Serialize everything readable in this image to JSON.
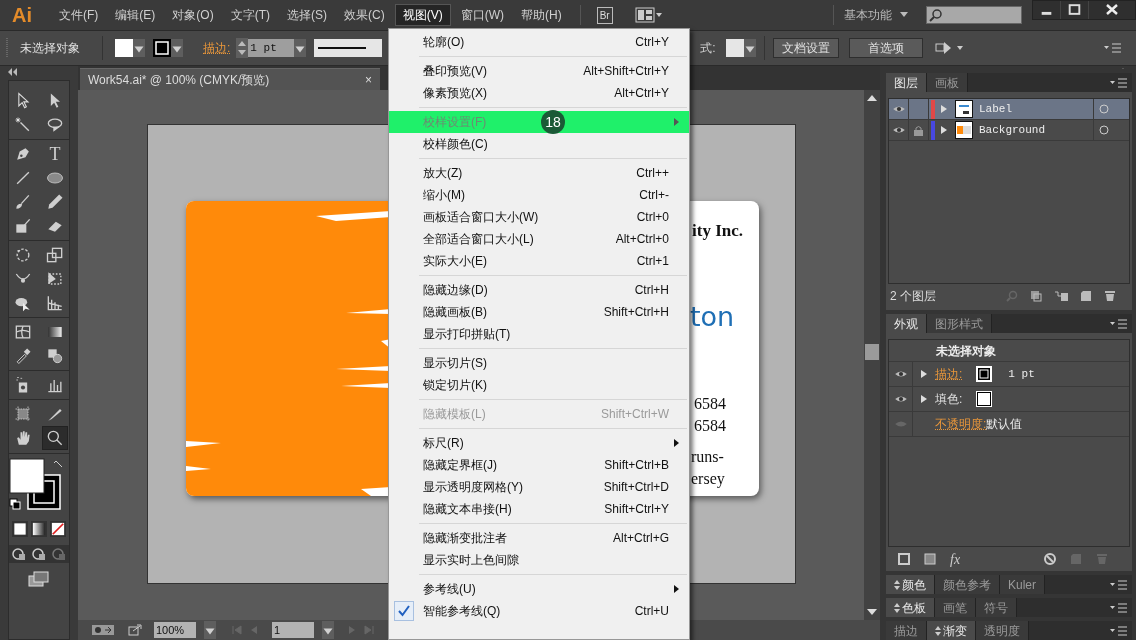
{
  "menubar": {
    "logo": "Ai",
    "menus": [
      {
        "label": "文件(F)",
        "selected": false
      },
      {
        "label": "编辑(E)",
        "selected": false
      },
      {
        "label": "对象(O)",
        "selected": false
      },
      {
        "label": "文字(T)",
        "selected": false
      },
      {
        "label": "选择(S)",
        "selected": false
      },
      {
        "label": "效果(C)",
        "selected": false
      },
      {
        "label": "视图(V)",
        "selected": true
      },
      {
        "label": "窗口(W)",
        "selected": false
      },
      {
        "label": "帮助(H)",
        "selected": false
      }
    ],
    "bridge": "Br",
    "workspace": "基本功能"
  },
  "control_bar": {
    "selection": "未选择对象",
    "stroke_label": "描边:",
    "stroke_weight": "1 pt",
    "style_label": "式:",
    "document_setup": "文档设置",
    "preferences": "首选项"
  },
  "document_tab": {
    "title": "Work54.ai* @ 100% (CMYK/预览)",
    "close": "×"
  },
  "tools": [
    {
      "kind": "select",
      "selected": false
    },
    {
      "kind": "direct",
      "selected": false
    },
    {
      "kind": "wand",
      "selected": false
    },
    {
      "kind": "lasso",
      "selected": false
    },
    {
      "kind": "pen",
      "selected": false
    },
    {
      "kind": "type",
      "glyph": "T",
      "selected": false
    },
    {
      "kind": "line",
      "selected": false
    },
    {
      "kind": "ellipse",
      "selected": false
    },
    {
      "kind": "brush",
      "selected": false
    },
    {
      "kind": "pencil",
      "selected": false
    },
    {
      "kind": "blob",
      "selected": false
    },
    {
      "kind": "eraser",
      "selected": false
    },
    {
      "kind": "rotate",
      "selected": false
    },
    {
      "kind": "scale",
      "selected": false
    },
    {
      "kind": "warp",
      "selected": false
    },
    {
      "kind": "transform",
      "selected": false
    },
    {
      "kind": "builder",
      "selected": false
    },
    {
      "kind": "grid",
      "selected": false
    },
    {
      "kind": "mesh",
      "selected": false
    },
    {
      "kind": "gradient",
      "selected": false
    },
    {
      "kind": "dropper",
      "selected": false
    },
    {
      "kind": "blend",
      "selected": false
    },
    {
      "kind": "sprayer",
      "selected": false
    },
    {
      "kind": "graph",
      "selected": false
    },
    {
      "kind": "artboard",
      "selected": false
    },
    {
      "kind": "slice",
      "selected": false
    },
    {
      "kind": "hand",
      "selected": false
    },
    {
      "kind": "zoom",
      "selected": true
    }
  ],
  "artwork": {
    "company": "ity Inc.",
    "name": "ton",
    "phone_1": "6584",
    "phone_2": "6584",
    "address_1": "runs-",
    "address_2": "ersey"
  },
  "view_menu": {
    "step_badge": "18",
    "groups": [
      [
        {
          "label": "轮廓(O)",
          "shortcut": "Ctrl+Y",
          "submenu": false,
          "disabled": false,
          "checked": false,
          "selected": false
        }
      ],
      [
        {
          "label": "叠印预览(V)",
          "shortcut": "Alt+Shift+Ctrl+Y",
          "submenu": false,
          "disabled": false,
          "checked": false,
          "selected": false
        },
        {
          "label": "像素预览(X)",
          "shortcut": "Alt+Ctrl+Y",
          "submenu": false,
          "disabled": false,
          "checked": false,
          "selected": false
        }
      ],
      [
        {
          "label": "校样设置(F)",
          "submenu": true,
          "disabled": false,
          "checked": false,
          "selected": true
        },
        {
          "label": "校样颜色(C)",
          "submenu": false,
          "disabled": false,
          "checked": false,
          "selected": false
        }
      ],
      [
        {
          "label": "放大(Z)",
          "shortcut": "Ctrl++",
          "submenu": false,
          "disabled": false,
          "checked": false,
          "selected": false
        },
        {
          "label": "缩小(M)",
          "shortcut": "Ctrl+-",
          "submenu": false,
          "disabled": false,
          "checked": false,
          "selected": false
        },
        {
          "label": "画板适合窗口大小(W)",
          "shortcut": "Ctrl+0",
          "submenu": false,
          "disabled": false,
          "checked": false,
          "selected": false
        },
        {
          "label": "全部适合窗口大小(L)",
          "shortcut": "Alt+Ctrl+0",
          "submenu": false,
          "disabled": false,
          "checked": false,
          "selected": false
        },
        {
          "label": "实际大小(E)",
          "shortcut": "Ctrl+1",
          "submenu": false,
          "disabled": false,
          "checked": false,
          "selected": false
        }
      ],
      [
        {
          "label": "隐藏边缘(D)",
          "shortcut": "Ctrl+H",
          "submenu": false,
          "disabled": false,
          "checked": false,
          "selected": false
        },
        {
          "label": "隐藏画板(B)",
          "shortcut": "Shift+Ctrl+H",
          "submenu": false,
          "disabled": false,
          "checked": false,
          "selected": false
        },
        {
          "label": "显示打印拼贴(T)",
          "submenu": false,
          "disabled": false,
          "checked": false,
          "selected": false
        }
      ],
      [
        {
          "label": "显示切片(S)",
          "submenu": false,
          "disabled": false,
          "checked": false,
          "selected": false
        },
        {
          "label": "锁定切片(K)",
          "submenu": false,
          "disabled": false,
          "checked": false,
          "selected": false
        }
      ],
      [
        {
          "label": "隐藏模板(L)",
          "shortcut": "Shift+Ctrl+W",
          "submenu": false,
          "disabled": true,
          "checked": false,
          "selected": false
        }
      ],
      [
        {
          "label": "标尺(R)",
          "submenu": true,
          "disabled": false,
          "checked": false,
          "selected": false
        },
        {
          "label": "隐藏定界框(J)",
          "shortcut": "Shift+Ctrl+B",
          "submenu": false,
          "disabled": false,
          "checked": false,
          "selected": false
        },
        {
          "label": "显示透明度网格(Y)",
          "shortcut": "Shift+Ctrl+D",
          "submenu": false,
          "disabled": false,
          "checked": false,
          "selected": false
        },
        {
          "label": "隐藏文本串接(H)",
          "shortcut": "Shift+Ctrl+Y",
          "submenu": false,
          "disabled": false,
          "checked": false,
          "selected": false
        }
      ],
      [
        {
          "label": "隐藏渐变批注者",
          "shortcut": "Alt+Ctrl+G",
          "submenu": false,
          "disabled": false,
          "checked": false,
          "selected": false
        },
        {
          "label": "显示实时上色间隙",
          "submenu": false,
          "disabled": false,
          "checked": false,
          "selected": false
        }
      ],
      [
        {
          "label": "参考线(U)",
          "submenu": true,
          "disabled": false,
          "checked": false,
          "selected": false
        },
        {
          "label": "智能参考线(Q)",
          "shortcut": "Ctrl+U",
          "submenu": false,
          "disabled": false,
          "checked": true,
          "selected": false
        }
      ]
    ]
  },
  "layers_panel": {
    "tabs": [
      {
        "label": "图层",
        "selected": true
      },
      {
        "label": "画板",
        "selected": false
      }
    ],
    "layers": [
      {
        "name": "Label",
        "color": "#e04848",
        "locked": false,
        "selected": true
      },
      {
        "name": "Background",
        "color": "#4848e0",
        "locked": true,
        "selected": false
      }
    ],
    "count": "2 个图层"
  },
  "appearance_panel": {
    "tabs": [
      {
        "label": "外观",
        "selected": true
      },
      {
        "label": "图形样式",
        "selected": false
      }
    ],
    "title": "未选择对象",
    "effects": "fx",
    "rows": [
      {
        "kind": "stroke",
        "label": "描边:",
        "value": "1 pt"
      },
      {
        "kind": "fill",
        "label": "填色:"
      },
      {
        "kind": "opacity",
        "label": "不透明度:",
        "value": "默认值"
      }
    ]
  },
  "panel_groups": [
    [
      {
        "label": "颜色",
        "selected": true
      },
      {
        "label": "颜色参考",
        "selected": false
      },
      {
        "label": "Kuler",
        "selected": false
      }
    ],
    [
      {
        "label": "色板",
        "selected": true
      },
      {
        "label": "画笔",
        "selected": false
      },
      {
        "label": "符号",
        "selected": false
      }
    ],
    [
      {
        "label": "描边",
        "selected": false
      },
      {
        "label": "渐变",
        "selected": true
      },
      {
        "label": "透明度",
        "selected": false
      }
    ]
  ],
  "status_bar": {
    "zoom": "100%",
    "artboard": "1"
  }
}
